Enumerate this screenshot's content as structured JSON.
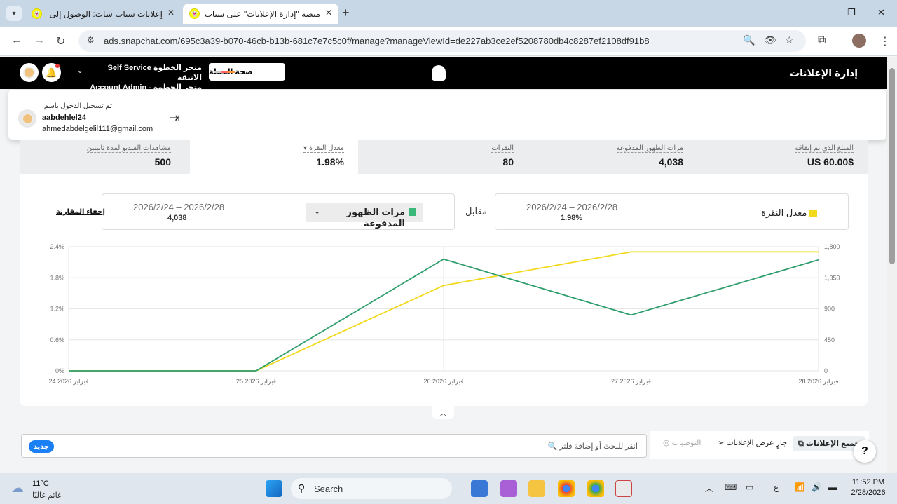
{
  "browser": {
    "tabs": [
      {
        "title": "إعلانات سناب شات: الوصول إلى",
        "active": false
      },
      {
        "title": "منصة \"إدارة الإعلانات\" على سناب",
        "active": true
      }
    ],
    "url": "ads.snapchat.com/695c3a39-b070-46cb-b13b-681c7e7c5c0f/manage?manageViewId=de227ab3ce2ef5208780db4c8287ef2108df91b8"
  },
  "appbar": {
    "title": "إدارة الإعلانات",
    "health_button": "صحة الحملة",
    "account_line1": "Self Service متجر الخطوة الانيقة",
    "account_line2": "Account Admin - متجر الخطوة الانيقة"
  },
  "popup": {
    "signed_in_as": ":تم تسجيل الدخول باسم",
    "username": "aabdehlel24",
    "email": "ahmedabdelgelil111@gmail.com"
  },
  "metrics": [
    {
      "label": "المبلغ الذي تم إنفاقه",
      "value": "$US 60.00"
    },
    {
      "label": "مرات الظهور المدفوعة",
      "value": "4,038"
    },
    {
      "label": "النقرات",
      "value": "80"
    },
    {
      "label": "معدل النقرة",
      "value": "1.98%"
    },
    {
      "label": "مشاهدات الفيديو لمدة ثانيتين",
      "value": "500"
    }
  ],
  "comparison": {
    "primary": {
      "name": "معدل النقرة",
      "dates": "2026/2/24 – 2026/2/28",
      "value": "1.98%"
    },
    "vs_label": "مقابل",
    "secondary": {
      "name": "مرات الظهور المدفوعة",
      "dates": "2026/2/24 – 2026/2/28",
      "value": "4,038"
    },
    "hide_label": "إخفاء المقارنة"
  },
  "chart_data": {
    "type": "line",
    "x": [
      "24 فبراير 2026",
      "25 فبراير 2026",
      "26 فبراير 2026",
      "27 فبراير 2026",
      "28 فبراير 2026"
    ],
    "series": [
      {
        "name": "معدل النقرة",
        "axis": "left",
        "color": "#f2d91c",
        "values": [
          0,
          0,
          1.65,
          2.3,
          2.3
        ]
      },
      {
        "name": "مرات الظهور المدفوعة",
        "axis": "right",
        "color": "#2e9e6d",
        "values": [
          0,
          0,
          1620,
          810,
          1610
        ]
      }
    ],
    "y_left": {
      "ticks": [
        "0%",
        "0.6%",
        "1.2%",
        "1.8%",
        "2.4%"
      ],
      "range": [
        0,
        2.4
      ]
    },
    "y_right": {
      "ticks": [
        "0",
        "450",
        "900",
        "1,350",
        "1,800"
      ],
      "range": [
        0,
        1800
      ]
    },
    "grid": true
  },
  "bottom": {
    "new_badge": "جديد",
    "search_placeholder": "انقر للبحث أو إضافة فلتر",
    "tab_all": "جميع الإعلانات",
    "tab_running": "جارٍ عرض الإعلانات",
    "tab_recommendations": "التوصيات"
  },
  "taskbar": {
    "temp": "11°C",
    "weather": "غائم غالبًا",
    "search": "Search",
    "time": "11:52 PM",
    "date": "2/28/2026"
  }
}
